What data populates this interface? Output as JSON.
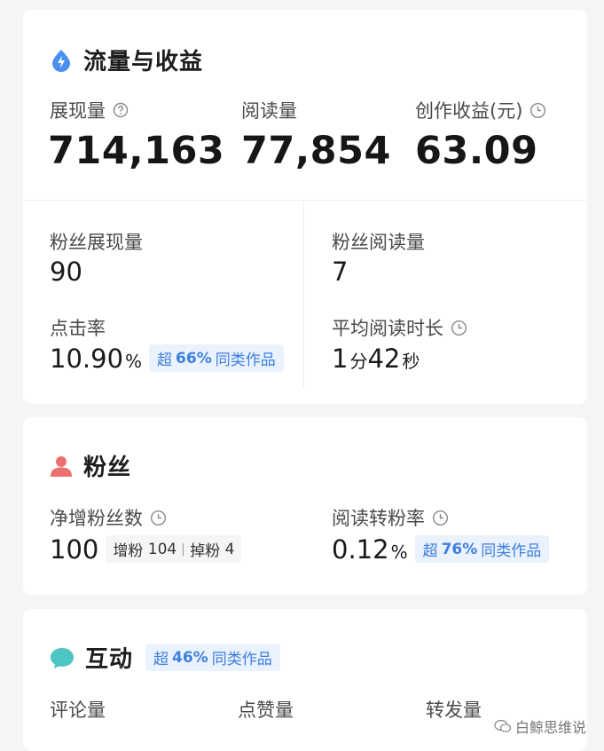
{
  "traffic": {
    "title": "流量与收益",
    "impressions": {
      "label": "展现量",
      "value": "714,163"
    },
    "reads": {
      "label": "阅读量",
      "value": "77,854"
    },
    "earnings": {
      "label": "创作收益(元)",
      "value": "63.09"
    },
    "fan_impressions": {
      "label": "粉丝展现量",
      "value": "90"
    },
    "fan_reads": {
      "label": "粉丝阅读量",
      "value": "7"
    },
    "ctr": {
      "label": "点击率",
      "value": "10.90",
      "unit": "%",
      "badge_prefix": "超",
      "badge_pct": "66%",
      "badge_suffix": "同类作品"
    },
    "avg_read_time": {
      "label": "平均阅读时长",
      "min_value": "1",
      "min_unit": "分",
      "sec_value": "42",
      "sec_unit": "秒"
    }
  },
  "fans": {
    "title": "粉丝",
    "net_gain": {
      "label": "净增粉丝数",
      "value": "100",
      "gain_label": "增粉",
      "gain_value": "104",
      "loss_label": "掉粉",
      "loss_value": "4"
    },
    "conversion": {
      "label": "阅读转粉率",
      "value": "0.12",
      "unit": "%",
      "badge_prefix": "超",
      "badge_pct": "76%",
      "badge_suffix": "同类作品"
    }
  },
  "interact": {
    "title": "互动",
    "badge_prefix": "超",
    "badge_pct": "46%",
    "badge_suffix": "同类作品",
    "comments": {
      "label": "评论量"
    },
    "likes": {
      "label": "点赞量"
    },
    "shares": {
      "label": "转发量"
    }
  },
  "watermark": {
    "text": "白鲸思维说"
  },
  "colors": {
    "traffic_icon": "#4a8ff0",
    "fans_icon": "#ee6f6f",
    "interact_icon": "#4cc5c3",
    "badge_bg": "#eaf2fd",
    "badge_text": "#3d7fe0"
  },
  "icons": {
    "traffic": "lightning-drop-icon",
    "fans": "person-icon",
    "interact": "chat-bubble-icon",
    "help": "question-circle-icon",
    "time": "clock-icon"
  }
}
